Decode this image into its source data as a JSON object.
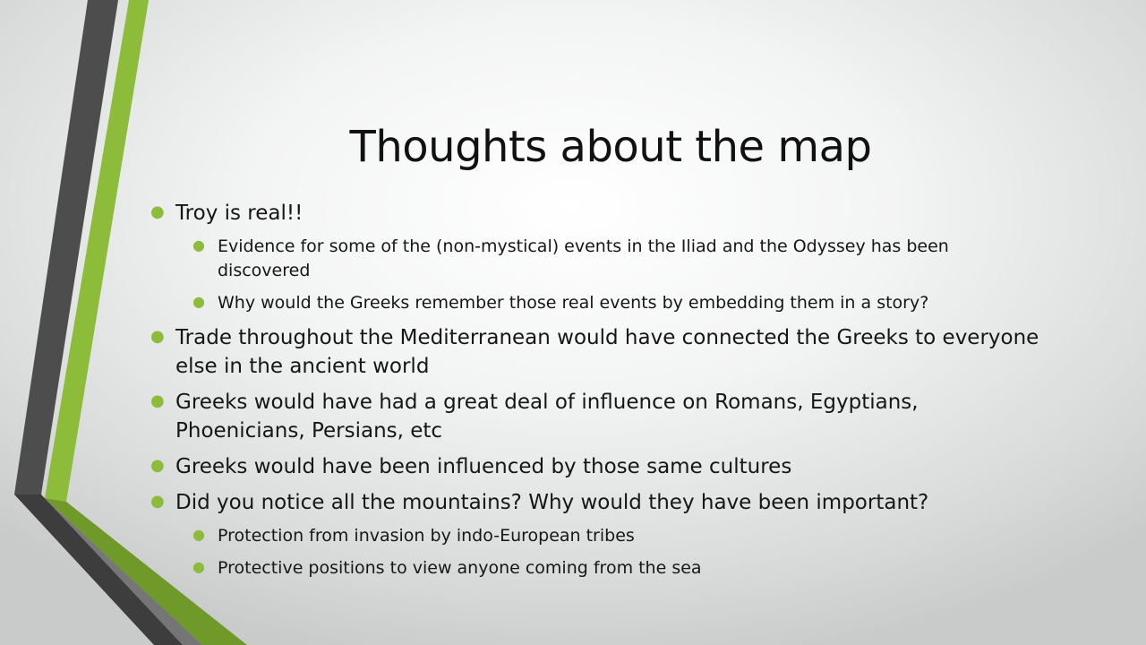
{
  "slide": {
    "title": "Thoughts about the map",
    "bullets": [
      {
        "level": 1,
        "text": "Troy is real!!"
      },
      {
        "level": 2,
        "text": "Evidence for some of the (non-mystical) events in the Iliad and the Odyssey has been discovered"
      },
      {
        "level": 2,
        "text": "Why would the Greeks remember those real events by embedding them in a story?"
      },
      {
        "level": 1,
        "text": "Trade throughout the Mediterranean would have connected the Greeks to everyone else in the ancient world"
      },
      {
        "level": 1,
        "text": "Greeks would have had a great deal of influence on Romans, Egyptians, Phoenicians, Persians, etc"
      },
      {
        "level": 1,
        "text": "Greeks would have been influenced by those same cultures"
      },
      {
        "level": 1,
        "text": "Did you notice all the mountains?  Why would they have been important?"
      },
      {
        "level": 2,
        "text": "Protection from invasion by indo-European tribes"
      },
      {
        "level": 2,
        "text": "Protective positions to view anyone coming from the sea"
      }
    ]
  },
  "colors": {
    "accent_green": "#8dbb3a",
    "dark_stripe": "#4a4a4a"
  }
}
